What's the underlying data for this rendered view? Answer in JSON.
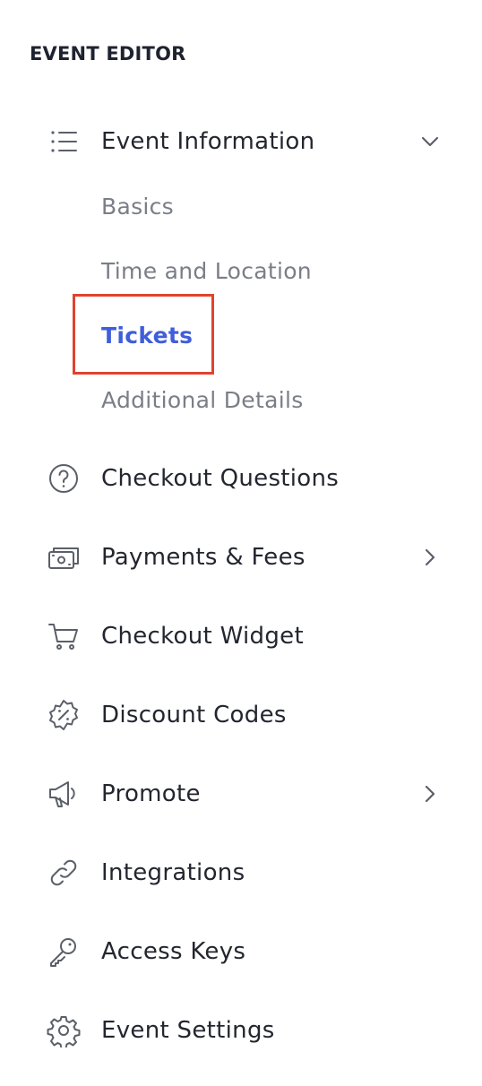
{
  "sidebar": {
    "title": "EVENT EDITOR",
    "event_information": {
      "label": "Event Information",
      "icon": "list-icon",
      "expanded": true,
      "sub_items": [
        {
          "label": "Basics",
          "active": false
        },
        {
          "label": "Time and Location",
          "active": false
        },
        {
          "label": "Tickets",
          "active": true
        },
        {
          "label": "Additional Details",
          "active": false
        }
      ]
    },
    "items": [
      {
        "label": "Checkout Questions",
        "icon": "question-circle-icon",
        "has_chevron": false
      },
      {
        "label": "Payments & Fees",
        "icon": "cash-icon",
        "has_chevron": true
      },
      {
        "label": "Checkout Widget",
        "icon": "cart-icon",
        "has_chevron": false
      },
      {
        "label": "Discount Codes",
        "icon": "discount-badge-icon",
        "has_chevron": false
      },
      {
        "label": "Promote",
        "icon": "megaphone-icon",
        "has_chevron": true
      },
      {
        "label": "Integrations",
        "icon": "link-icon",
        "has_chevron": false
      },
      {
        "label": "Access Keys",
        "icon": "key-icon",
        "has_chevron": false
      },
      {
        "label": "Event Settings",
        "icon": "gear-icon",
        "has_chevron": false
      }
    ]
  },
  "colors": {
    "text_primary": "#23262f",
    "text_secondary": "#7a7e87",
    "active": "#3f5ed9",
    "highlight_border": "#e0432f",
    "icon": "#5b5f69"
  }
}
